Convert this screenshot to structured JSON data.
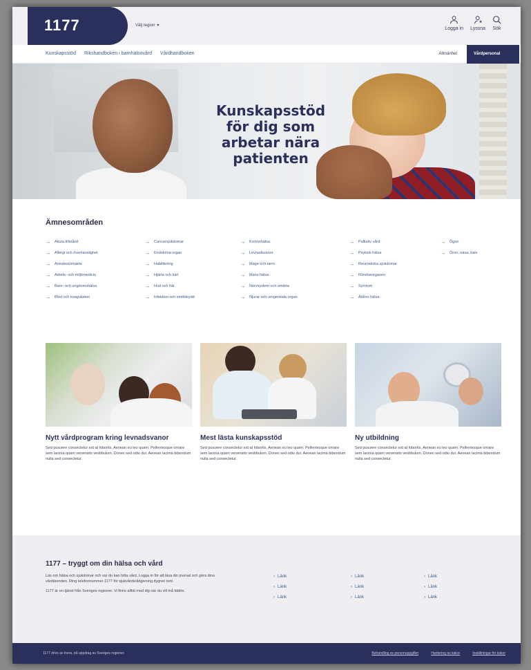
{
  "header": {
    "logo": "1177",
    "region": "Välj region",
    "tools": [
      {
        "label": "Logga in",
        "icon": "user-icon"
      },
      {
        "label": "Lyssna",
        "icon": "listen-icon"
      },
      {
        "label": "Sök",
        "icon": "search-icon"
      }
    ]
  },
  "nav": {
    "links": [
      "Kunskapsstöd",
      "Rikshandboken i barnhälsovård",
      "Vårdhandboken"
    ],
    "audience_public": "Allmänhet",
    "audience_pro": "Vårdpersonal"
  },
  "hero": {
    "title": "Kunskapsstöd för dig som arbetar nära patienten"
  },
  "subjects": {
    "heading": "Ämnesområden",
    "columns": [
      [
        "Akuta tillstånd",
        "Allergi och överkänslighet",
        "Anestesi/smärta",
        "Arbets- och miljömedicin",
        "Barn- och ungdomshälsa",
        "Blod och koagulation"
      ],
      [
        "Cancersjukdomar",
        "Endokrina organ",
        "Habilitering",
        "Hjärta och kärl",
        "Hud och hår",
        "Infektion och smittskydd"
      ],
      [
        "Kvinnohälsa",
        "Levnadsvanor",
        "Mage och tarm",
        "Mans hälsa",
        "Nervsystem och smärta",
        "Njurar och urogenitala organ"
      ],
      [
        "Palliativ vård",
        "Psykisk hälsa",
        "Reumatiska sjukdomar",
        "Rörelseorganen",
        "Symtom",
        "Äldres hälsa"
      ],
      [
        "Ögon",
        "Öron, näsa, hals"
      ]
    ]
  },
  "cards": [
    {
      "title": "Nytt vårdprogram kring levnadsvanor",
      "text": "Sed posuere consectetur est at lobortis. Aenean eu leo quam. Pellentesque ornare sem lacinia quam venenatis vestibulum. Donec sed odio dui. Aenean lacinia bibendum nulla sed consectetur."
    },
    {
      "title": "Mest lästa kunskapsstöd",
      "text": "Sed posuere consectetur est at lobortis. Aenean eu leo quam. Pellentesque ornare sem lacinia quam venenatis vestibulum. Donec sed odio dui. Aenean lacinia bibendum nulla sed consectetur."
    },
    {
      "title": "Ny utbildning",
      "text": "Sed posuere consectetur est at lobortis. Aenean eu leo quam. Pellentesque ornare sem lacinia quam venenatis vestibulum. Donec sed odio dui. Aenean lacinia bibendum nulla sed consectetur."
    }
  ],
  "info": {
    "heading": "1177 – tryggt om din hälsa och vård",
    "para1": "Läs om hälsa och sjukdomar och var du kan hitta vård. Logga in för att läsa din journal och göra dina vårdärenden. Ring telefonnummer 1177 för sjukvårdsrådgivning dygnet runt.",
    "para2": "1177 är en tjänst från Sveriges regioner. Vi finns alltid med dig när du vill må bättre.",
    "links": [
      "Länk",
      "Länk",
      "Länk",
      "Länk",
      "Länk",
      "Länk",
      "Länk",
      "Länk",
      "Länk"
    ]
  },
  "footer": {
    "left": "1177 drivs av Inera, på uppdrag av Sveriges regioner.",
    "links": [
      "Behandling av personuppgifter",
      "Hantering av kakor",
      "Inställningar för kakor"
    ]
  },
  "colors": {
    "brand": "#2b2f5c",
    "link": "#3b5b8e",
    "info_bg": "#eeeef3"
  }
}
